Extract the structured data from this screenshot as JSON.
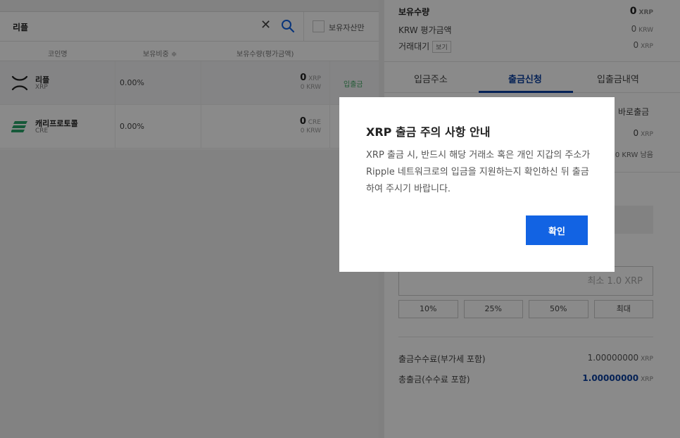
{
  "search": {
    "query": "리플",
    "clear_icon": "close-icon",
    "search_icon": "search-icon",
    "owned_only_label": "보유자산만"
  },
  "table": {
    "headers": {
      "name": "코인명",
      "weight": "보유비중 ≑",
      "holdings": "보유수량(평가금액)"
    },
    "rows": [
      {
        "name": "리플",
        "symbol": "XRP",
        "weight": "0.00%",
        "qty": "0",
        "qty_unit": "XRP",
        "krw": "0",
        "krw_unit": "KRW",
        "action": "입출금",
        "icon": "ripple-logo-icon"
      },
      {
        "name": "캐리프로토콜",
        "symbol": "CRE",
        "weight": "0.00%",
        "qty": "0",
        "qty_unit": "CRE",
        "krw": "0",
        "krw_unit": "KRW",
        "action": "",
        "icon": "carry-protocol-logo-icon"
      }
    ]
  },
  "summary": {
    "holdings_label": "보유수량",
    "holdings_value": "0",
    "holdings_unit": "XRP",
    "krw_label": "KRW 평가금액",
    "krw_value": "0",
    "krw_unit": "KRW",
    "pending_label": "거래대기",
    "pending_btn": "보기",
    "pending_value": "0",
    "pending_unit": "XRP"
  },
  "tabs": [
    {
      "label": "입금주소",
      "active": false
    },
    {
      "label": "출금신청",
      "active": true
    },
    {
      "label": "입출금내역",
      "active": false
    }
  ],
  "withdraw": {
    "partial_express": "바로출금",
    "partial_value": "0",
    "partial_value_unit": "XRP",
    "partial_remaining": "0 KRW 남음",
    "amount_placeholder": "최소 1.0 XRP",
    "percent_buttons": [
      "10%",
      "25%",
      "50%",
      "최대"
    ],
    "fee_label": "출금수수료(부가세 포함)",
    "fee_value": "1.00000000",
    "fee_unit": "XRP",
    "total_label": "총출금(수수료 포함)",
    "total_value": "1.00000000",
    "total_unit": "XRP"
  },
  "modal": {
    "title": "XRP 출금 주의 사항 안내",
    "body": "XRP 출금 시, 반드시 해당 거래소 혹은 개인 지갑의 주소가 Ripple 네트워크로의 입금을 지원하는지 확인하신 뒤 출금하여 주시기 바랍니다.",
    "confirm_label": "확인"
  },
  "colors": {
    "accent": "#1263e3",
    "tab_active": "#0b3fa0",
    "overlay": "rgba(0,0,0,0.46)",
    "action_green": "#44aa66"
  }
}
